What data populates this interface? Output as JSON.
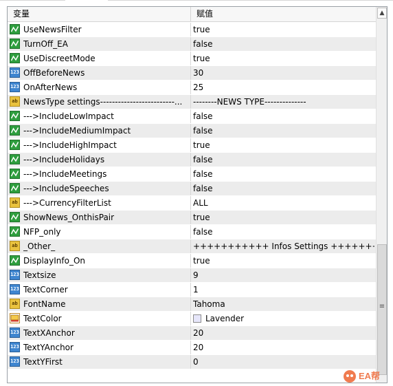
{
  "header": {
    "col_variable": "变量",
    "col_value": "赋值"
  },
  "rows": [
    {
      "name": "UseNewsFilter",
      "value": "true",
      "type": "bool-icon"
    },
    {
      "name": "TurnOff_EA",
      "value": "false",
      "type": "bool-icon"
    },
    {
      "name": "UseDiscreetMode",
      "value": "true",
      "type": "bool-icon"
    },
    {
      "name": "OffBeforeNews",
      "value": "30",
      "type": "number-icon",
      "badge": "123"
    },
    {
      "name": "OnAfterNews",
      "value": "25",
      "type": "number-icon",
      "badge": "123"
    },
    {
      "name": "NewsType settings-------------------------...",
      "value": "--------NEWS TYPE--------------",
      "type": "string-icon",
      "badge": "ab"
    },
    {
      "name": "--->IncludeLowImpact",
      "value": "false",
      "type": "bool-icon"
    },
    {
      "name": "--->IncludeMediumImpact",
      "value": "false",
      "type": "bool-icon"
    },
    {
      "name": "--->IncludeHighImpact",
      "value": "true",
      "type": "bool-icon"
    },
    {
      "name": "--->IncludeHolidays",
      "value": "false",
      "type": "bool-icon"
    },
    {
      "name": "--->IncludeMeetings",
      "value": "false",
      "type": "bool-icon"
    },
    {
      "name": "--->IncludeSpeeches",
      "value": "false",
      "type": "bool-icon"
    },
    {
      "name": "--->CurrencyFilterList",
      "value": "ALL",
      "type": "string-icon",
      "badge": "ab"
    },
    {
      "name": "ShowNews_OnthisPair",
      "value": "true",
      "type": "bool-icon"
    },
    {
      "name": "NFP_only",
      "value": "false",
      "type": "bool-icon"
    },
    {
      "name": "_Other_",
      "value": "+++++++++++ Infos Settings +++++++++++",
      "type": "string-icon",
      "badge": "ab"
    },
    {
      "name": "DisplayInfo_On",
      "value": "true",
      "type": "bool-icon"
    },
    {
      "name": "Textsize",
      "value": "9",
      "type": "number-icon",
      "badge": "123"
    },
    {
      "name": "TextCorner",
      "value": "1",
      "type": "number-icon",
      "badge": "123"
    },
    {
      "name": "FontName",
      "value": "Tahoma",
      "type": "string-icon",
      "badge": "ab"
    },
    {
      "name": "TextColor",
      "value": "Lavender",
      "type": "color-icon",
      "swatch": "#e6e6fa"
    },
    {
      "name": "TextXAnchor",
      "value": "20",
      "type": "number-icon",
      "badge": "123"
    },
    {
      "name": "TextYAnchor",
      "value": "20",
      "type": "number-icon",
      "badge": "123"
    },
    {
      "name": "TextYFirst",
      "value": "0",
      "type": "number-icon",
      "badge": "123"
    }
  ],
  "scrollbar": {
    "up_arrow": "▲",
    "grip": "≡",
    "position": 0.63
  },
  "watermark": {
    "text": "EA帮"
  },
  "colors": {
    "bool_icon": "#2e9e3e",
    "number_icon": "#3f86d0",
    "string_icon": "#e9c23e",
    "alt_row": "#ececec",
    "watermark": "#f07b4f"
  }
}
